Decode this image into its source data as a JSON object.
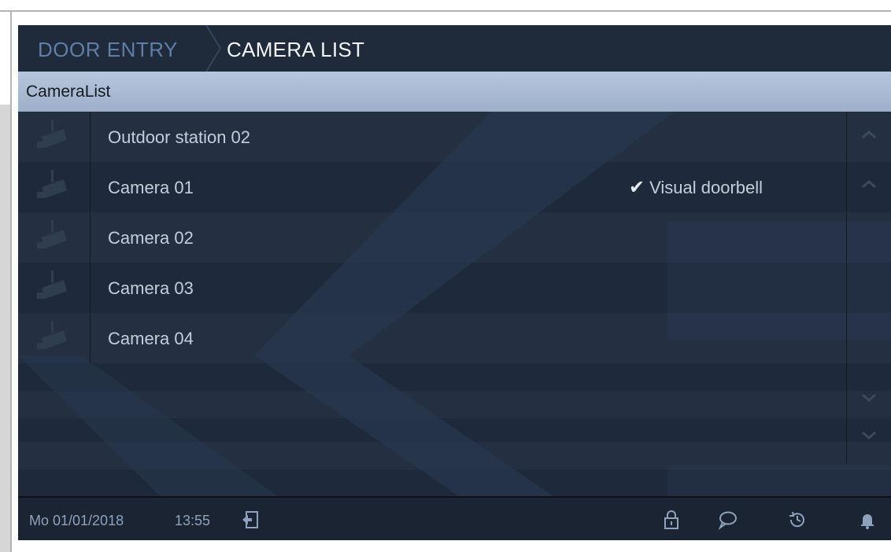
{
  "header": {
    "breadcrumb_parent": "DOOR ENTRY",
    "breadcrumb_current": "CAMERA LIST"
  },
  "list": {
    "header_label": "CameraList",
    "items": [
      {
        "label": "Outdoor station 02",
        "status": "",
        "icon": "security-camera-icon"
      },
      {
        "label": "Camera 01",
        "status": "Visual doorbell",
        "icon": "security-camera-icon"
      },
      {
        "label": "Camera 02",
        "status": "",
        "icon": "security-camera-icon"
      },
      {
        "label": "Camera 03",
        "status": "",
        "icon": "security-camera-icon"
      },
      {
        "label": "Camera 04",
        "status": "",
        "icon": "security-camera-icon"
      }
    ]
  },
  "scroll": {
    "up_icon": "chevron-up-icon",
    "page_up_icon": "chevron-up-icon",
    "page_down_icon": "chevron-down-icon",
    "down_icon": "chevron-down-icon"
  },
  "footer": {
    "date": "Mo 01/01/2018",
    "time": "13:55",
    "icons": [
      "exit-icon",
      "lock-icon",
      "message-icon",
      "history-icon",
      "bell-icon"
    ]
  },
  "colors": {
    "background": "#1d2838",
    "list_header": "#b6c6dc",
    "breadcrumb_parent": "#5f7fa8",
    "text": "#c4cedb"
  }
}
